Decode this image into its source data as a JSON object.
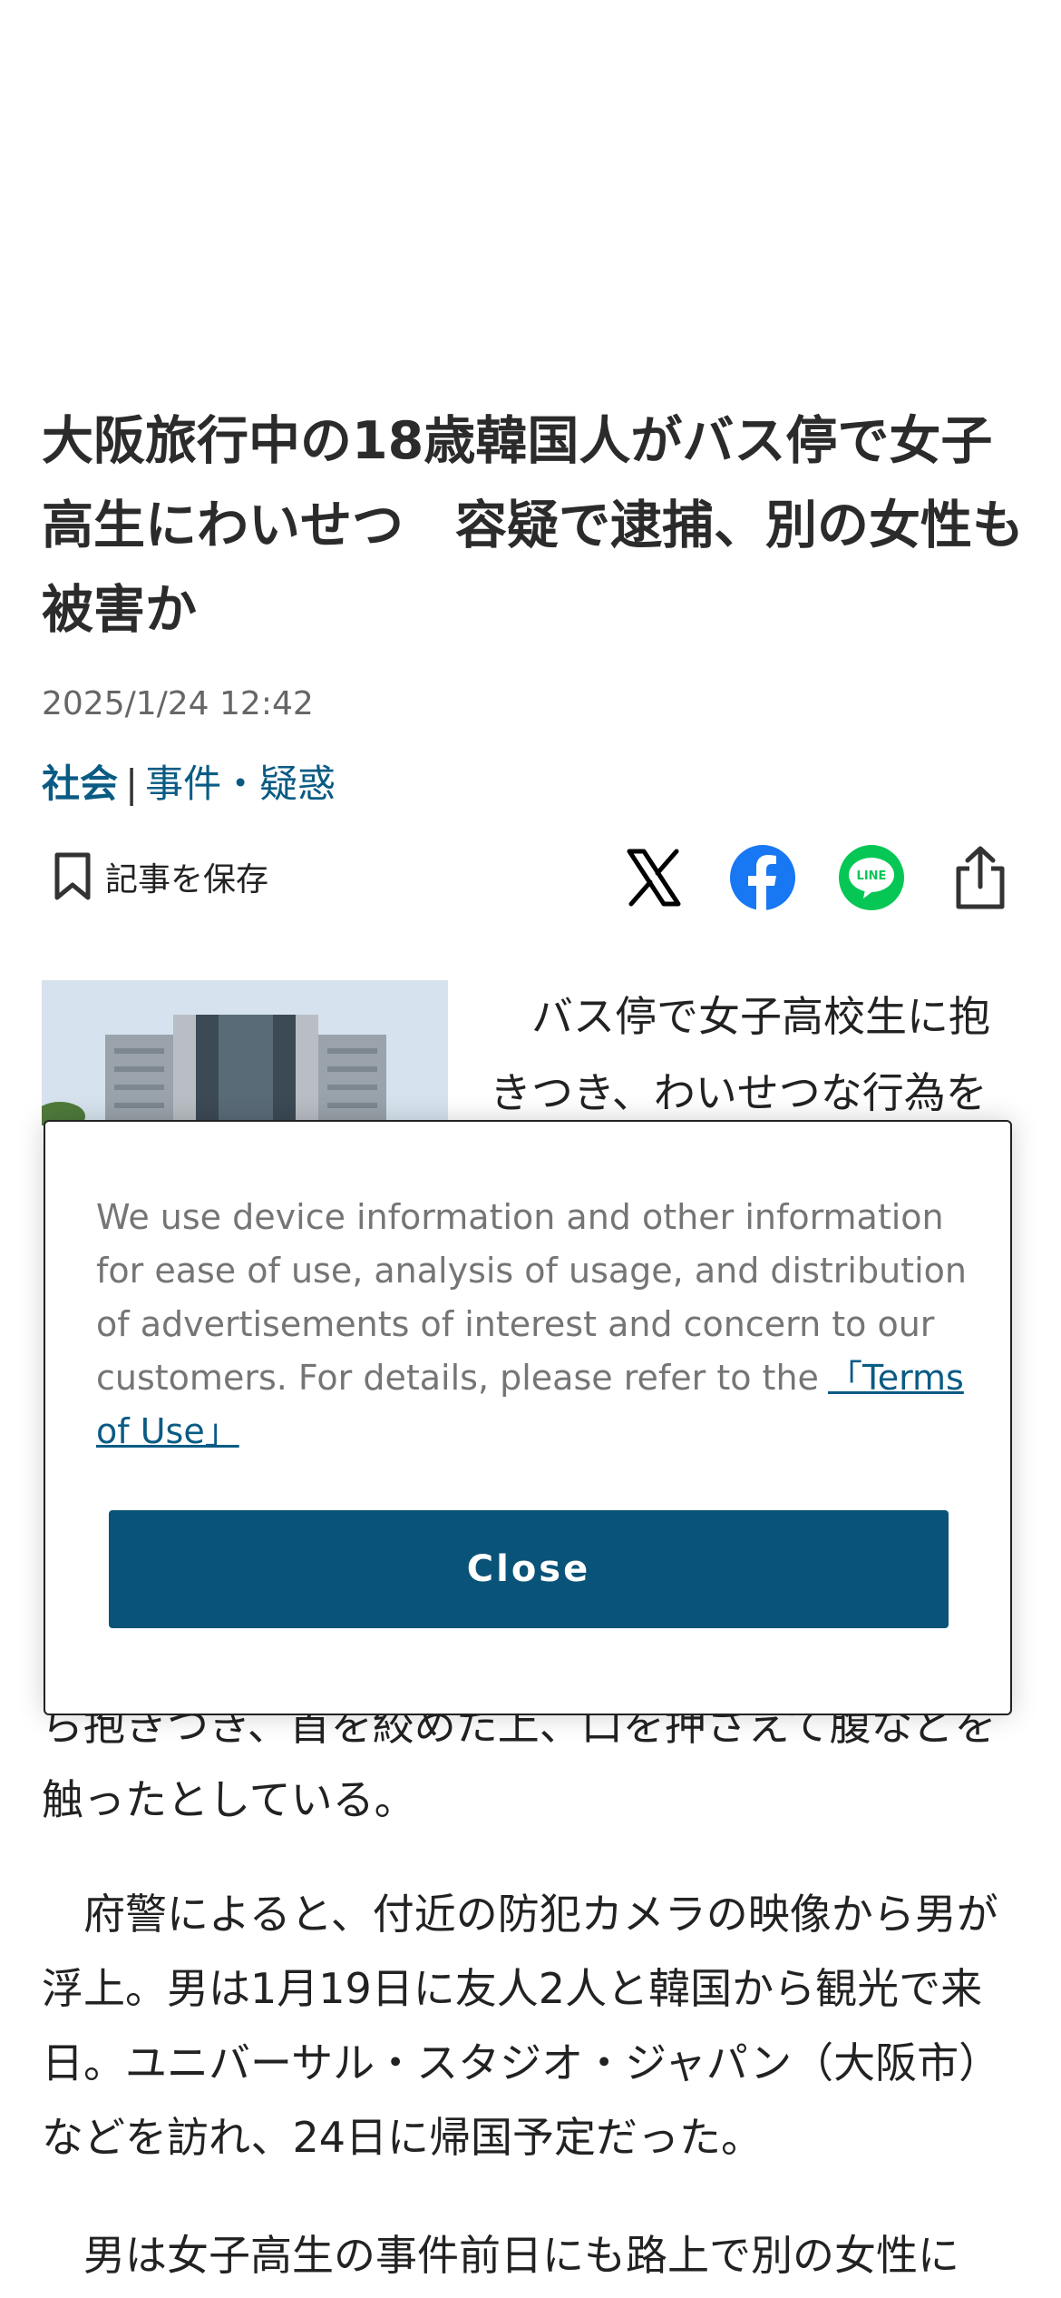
{
  "article": {
    "headline": "大阪旅行中の18歳韓国人がバス停で女子高生にわいせつ　容疑で逮捕、別の女性も被害か",
    "date": "2025/1/24 12:42",
    "category": {
      "main": "社会",
      "separator": "|",
      "sub": "事件・疑惑"
    },
    "save_label": "記事を保存",
    "share": [
      {
        "name": "x-icon",
        "color": "#000000"
      },
      {
        "name": "facebook-icon",
        "color": "#1877F2"
      },
      {
        "name": "line-icon",
        "color": "#06C755",
        "text": "LINE"
      },
      {
        "name": "share-icon",
        "color": "#333333"
      }
    ],
    "lead_visible": "バス停で女子高校生に抱きつき、わいせつな行為を",
    "paragraph1_visible": "ら抱きつき、首を絞めた上、口を押さえて腹などを触ったとしている。",
    "paragraph2": "府警によると、付近の防犯カメラの映像から男が浮上。男は1月19日に友人2人と韓国から観光で来日。ユニバーサル・スタジオ・ジャパン（大阪市）などを訪れ、24日に帰国予定だった。",
    "paragraph3_visible": "男は女子高生の事件前日にも路上で別の女性に"
  },
  "consent": {
    "text": "We use device information and other information for ease of use, analysis of usage, and distribution of advertisements of interest and concern to our customers. For details, please refer to the",
    "link_label": "「Terms of Use」",
    "close_label": "Close"
  },
  "colors": {
    "accent": "#0a5378",
    "category": "#0a5b84",
    "text": "#222222",
    "muted": "#757575"
  }
}
